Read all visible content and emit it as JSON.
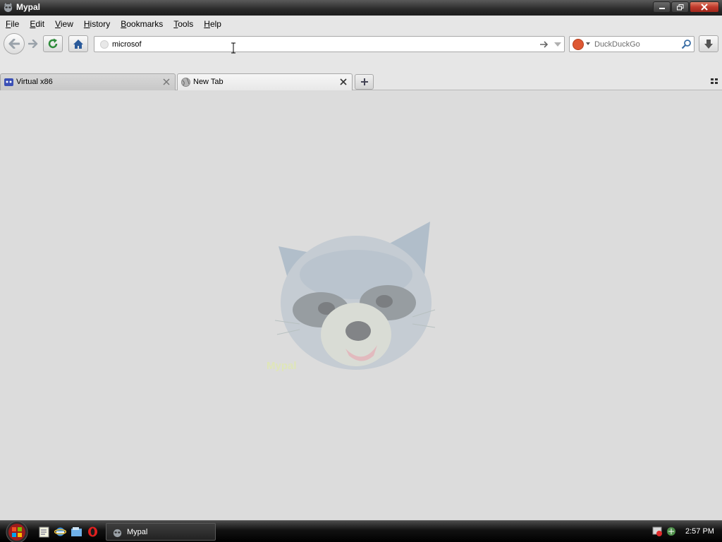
{
  "window": {
    "title": "Mypal"
  },
  "menubar": {
    "items": [
      {
        "label": "File",
        "accesskey": "F",
        "rest": "ile"
      },
      {
        "label": "Edit",
        "accesskey": "E",
        "rest": "dit"
      },
      {
        "label": "View",
        "accesskey": "V",
        "rest": "iew"
      },
      {
        "label": "History",
        "accesskey": "H",
        "rest": "istory"
      },
      {
        "label": "Bookmarks",
        "accesskey": "B",
        "rest": "ookmarks"
      },
      {
        "label": "Tools",
        "accesskey": "T",
        "rest": "ools"
      },
      {
        "label": "Help",
        "accesskey": "H",
        "rest": "elp"
      }
    ]
  },
  "navbar": {
    "url_value": "microsof",
    "search_placeholder": "DuckDuckGo",
    "search_engine_icon": "duckduckgo-icon"
  },
  "tabs": [
    {
      "label": "Virtual x86",
      "active": false,
      "favicon": "virtual-x86-icon"
    },
    {
      "label": "New Tab",
      "active": true,
      "favicon": "globe-icon"
    }
  ],
  "content": {
    "mascot_caption": "Mypal"
  },
  "taskbar": {
    "task_label": "Mypal",
    "clock": "2:57 PM"
  },
  "colors": {
    "titlebar": "#2a2a2a",
    "chrome": "#e6e6e6",
    "content_bg": "#dcdcdc",
    "close_button": "#c0392b",
    "home_icon": "#2a5a9a",
    "reload_icon": "#2e8b3a"
  }
}
